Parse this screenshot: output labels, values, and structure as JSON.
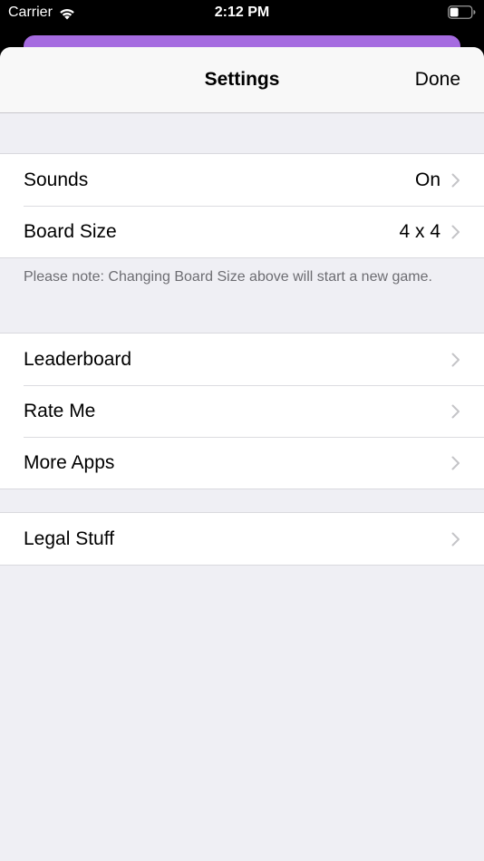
{
  "status_bar": {
    "carrier": "Carrier",
    "time": "2:12 PM"
  },
  "nav": {
    "title": "Settings",
    "done_label": "Done"
  },
  "groups": {
    "general": {
      "sounds": {
        "label": "Sounds",
        "value": "On"
      },
      "board_size": {
        "label": "Board Size",
        "value": "4 x 4"
      },
      "footnote": "Please note: Changing Board Size above will start a new game."
    },
    "social": {
      "leaderboard": {
        "label": "Leaderboard"
      },
      "rate_me": {
        "label": "Rate Me"
      },
      "more_apps": {
        "label": "More Apps"
      }
    },
    "legal": {
      "legal_stuff": {
        "label": "Legal Stuff"
      }
    }
  },
  "colors": {
    "accent_underlay": "#a56be0",
    "background": "#efeff4",
    "footnote_text": "#6d6d72",
    "chevron": "#c4c4c7"
  },
  "icons": {
    "wifi": "wifi-icon",
    "battery": "battery-icon",
    "chevron": "chevron-right-icon"
  }
}
